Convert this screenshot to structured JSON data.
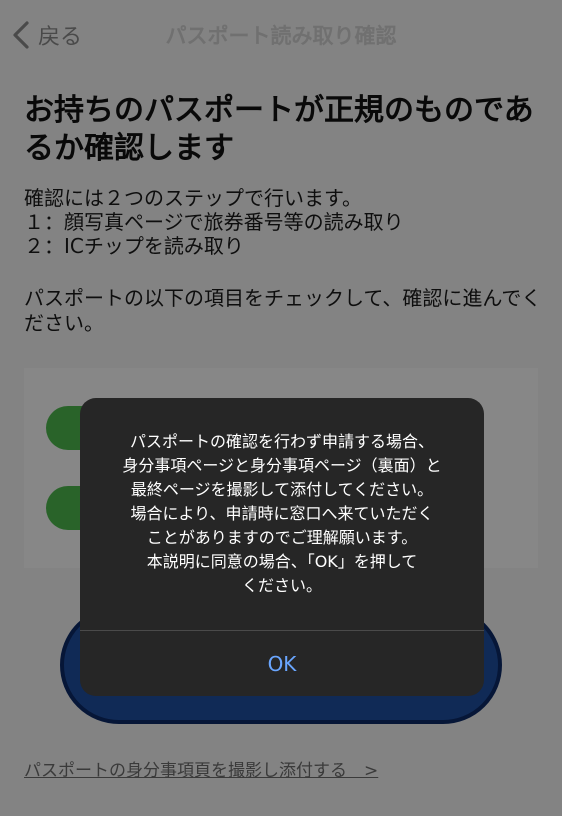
{
  "nav": {
    "back_label": "戻る",
    "title": "パスポート読み取り確認"
  },
  "main": {
    "heading": "お持ちのパスポートが正規のものであるか確認します",
    "steps_intro": "確認には２つのステップで行います。",
    "steps": [
      "１：顔写真ページで旅券番号等の読み取り",
      "２：ICチップを読み取り"
    ],
    "check_text": "パスポートの以下の項目をチェックして、確認に進んでください。",
    "attach_link": "パスポートの身分事項頁を撮影し添付する　>"
  },
  "alert": {
    "message_lines": [
      "パスポートの確認を行わず申請する場合、",
      "身分事項ページと身分事項ページ（裏面）と",
      "最終ページを撮影して添付してください。",
      "場合により、申請時に窓口へ来ていただく",
      "ことがありますのでご理解願います。",
      "本説明に同意の場合、「OK」を押して",
      "ください。"
    ],
    "ok_label": "OK"
  },
  "icons": {
    "back": "chevron-left-icon"
  },
  "colors": {
    "toggle_on": "#4cb84c",
    "primary": "#1f4fa0",
    "alert_button": "#6aa6ff"
  }
}
